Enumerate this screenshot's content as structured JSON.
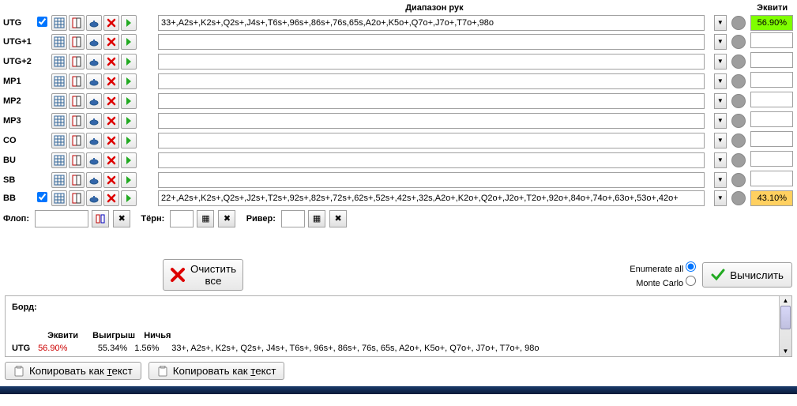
{
  "headers": {
    "range": "Диапазон рук",
    "equity": "Эквити"
  },
  "positions": [
    {
      "name": "UTG",
      "checkbox": true,
      "checked": true,
      "range": "33+,A2s+,K2s+,Q2s+,J4s+,T6s+,96s+,86s+,76s,65s,A2o+,K5o+,Q7o+,J7o+,T7o+,98o",
      "equity": "56.90%",
      "eqClass": "eq-green"
    },
    {
      "name": "UTG+1",
      "checkbox": false,
      "checked": false,
      "range": "",
      "equity": "",
      "eqClass": ""
    },
    {
      "name": "UTG+2",
      "checkbox": false,
      "checked": false,
      "range": "",
      "equity": "",
      "eqClass": ""
    },
    {
      "name": "MP1",
      "checkbox": false,
      "checked": false,
      "range": "",
      "equity": "",
      "eqClass": ""
    },
    {
      "name": "MP2",
      "checkbox": false,
      "checked": false,
      "range": "",
      "equity": "",
      "eqClass": ""
    },
    {
      "name": "MP3",
      "checkbox": false,
      "checked": false,
      "range": "",
      "equity": "",
      "eqClass": ""
    },
    {
      "name": "CO",
      "checkbox": false,
      "checked": false,
      "range": "",
      "equity": "",
      "eqClass": ""
    },
    {
      "name": "BU",
      "checkbox": false,
      "checked": false,
      "range": "",
      "equity": "",
      "eqClass": ""
    },
    {
      "name": "SB",
      "checkbox": false,
      "checked": false,
      "range": "",
      "equity": "",
      "eqClass": ""
    },
    {
      "name": "BB",
      "checkbox": true,
      "checked": true,
      "range": "22+,A2s+,K2s+,Q2s+,J2s+,T2s+,92s+,82s+,72s+,62s+,52s+,42s+,32s,A2o+,K2o+,Q2o+,J2o+,T2o+,92o+,84o+,74o+,63o+,53o+,42o+",
      "equity": "43.10%",
      "eqClass": "eq-yellow"
    }
  ],
  "board": {
    "flopLabel": "Флоп:",
    "turnLabel": "Тёрн:",
    "riverLabel": "Ривер:",
    "flop": "",
    "turn": "",
    "river": ""
  },
  "buttons": {
    "clearAll1": "Очистить",
    "clearAll2": "все",
    "enumerate": "Enumerate all",
    "montecarlo": "Monte Carlo",
    "calculate": "Вычислить",
    "copyText": "Копировать как текст"
  },
  "calcMode": "enumerate",
  "results": {
    "boardLabel": "Борд:",
    "headers": {
      "equity": "Эквити",
      "win": "Выигрыш",
      "tie": "Ничья"
    },
    "rows": [
      {
        "pos": "UTG",
        "equity": "56.90%",
        "win": "55.34%",
        "tie": "1.56%",
        "range": "33+, A2s+, K2s+, Q2s+, J4s+, T6s+, 96s+, 86s+, 76s, 65s, A2o+, K5o+, Q7o+, J7o+, T7o+, 98o"
      }
    ]
  },
  "copyLabelPrefix": "Копировать как ",
  "copyLabelKey": "т",
  "copyLabelSuffix": "екст"
}
